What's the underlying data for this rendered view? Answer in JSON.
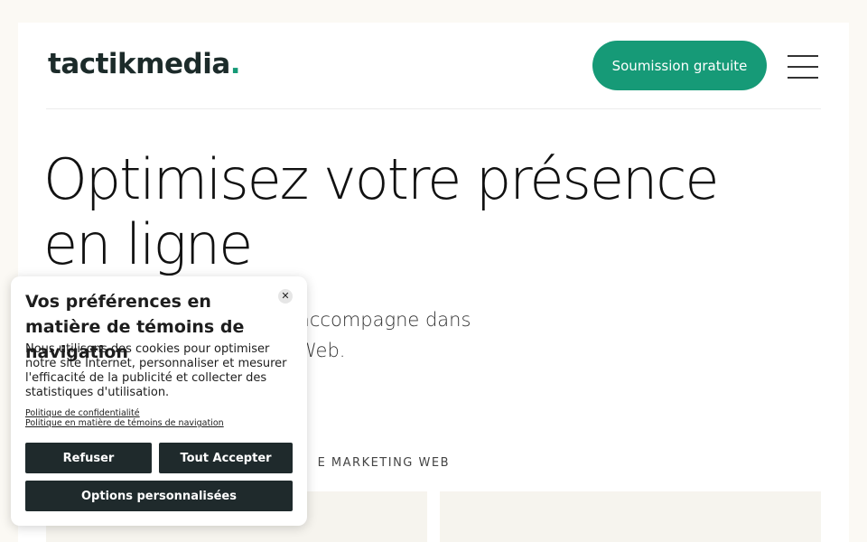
{
  "header": {
    "logo_text": "tactikmedia",
    "logo_dot": ".",
    "cta_label": "Soumission gratuite",
    "menu_icon": "hamburger-icon"
  },
  "hero": {
    "title": "Optimisez votre présence en ligne",
    "subtitle_visible": "accompagne dans\nWeb."
  },
  "section": {
    "label_visible": "E MARKETING WEB"
  },
  "cookie_banner": {
    "title": "Vos préférences en matière de témoins de navigation",
    "body": "Nous utilisons des cookies pour optimiser notre site Internet, personnaliser et mesurer l'efficacité de la publicité et collecter des statistiques d'utilisation.",
    "privacy_link": "Politique de confidentialité",
    "cookie_policy_link": "Politique en matière de témoins de navigation",
    "refuse_label": "Refuser",
    "accept_label": "Tout Accepter",
    "options_label": "Options personnalisées",
    "close_icon": "close-icon"
  },
  "colors": {
    "accent": "#169a77",
    "dark_button": "#1f2a2c",
    "page_bg": "#fbf9f4"
  }
}
